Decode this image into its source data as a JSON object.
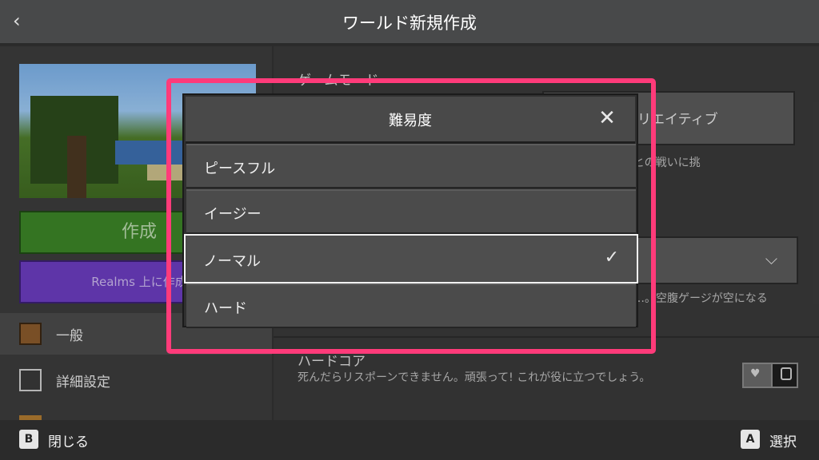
{
  "header": {
    "title": "ワールド新規作成",
    "back_icon": "chevron-left-icon"
  },
  "sidebar": {
    "create_label": "作成",
    "realms_label": "Realms 上に作成",
    "items": [
      {
        "label": "一般",
        "icon": "gear-block-icon"
      },
      {
        "label": "詳細設定",
        "icon": "helmet-icon"
      },
      {
        "label": "",
        "icon": "block-icon"
      }
    ]
  },
  "main": {
    "game_mode_label": "ゲームモード",
    "game_mode_value": "クリエイティブ",
    "game_mode_desc": "モンスターとの戦いに挑",
    "difficulty_desc": "…。空腹ゲージが空になる",
    "hardcore_label": "ハードコア",
    "hardcore_desc": "死んだらリスポーンできません。頑張って! これが役に立つでしょう。",
    "hardcore_enabled": false
  },
  "dialog": {
    "title": "難易度",
    "options": [
      {
        "label": "ピースフル",
        "selected": false
      },
      {
        "label": "イージー",
        "selected": false
      },
      {
        "label": "ノーマル",
        "selected": true
      },
      {
        "label": "ハード",
        "selected": false
      }
    ],
    "check_icon": "checkmark-icon",
    "close_icon": "close-icon"
  },
  "footer": {
    "close_key": "B",
    "close_label": "閉じる",
    "select_key": "A",
    "select_label": "選択"
  },
  "colors": {
    "highlight": "#ff3b7a",
    "create": "#3c8527",
    "realms": "#6b3dc0"
  }
}
